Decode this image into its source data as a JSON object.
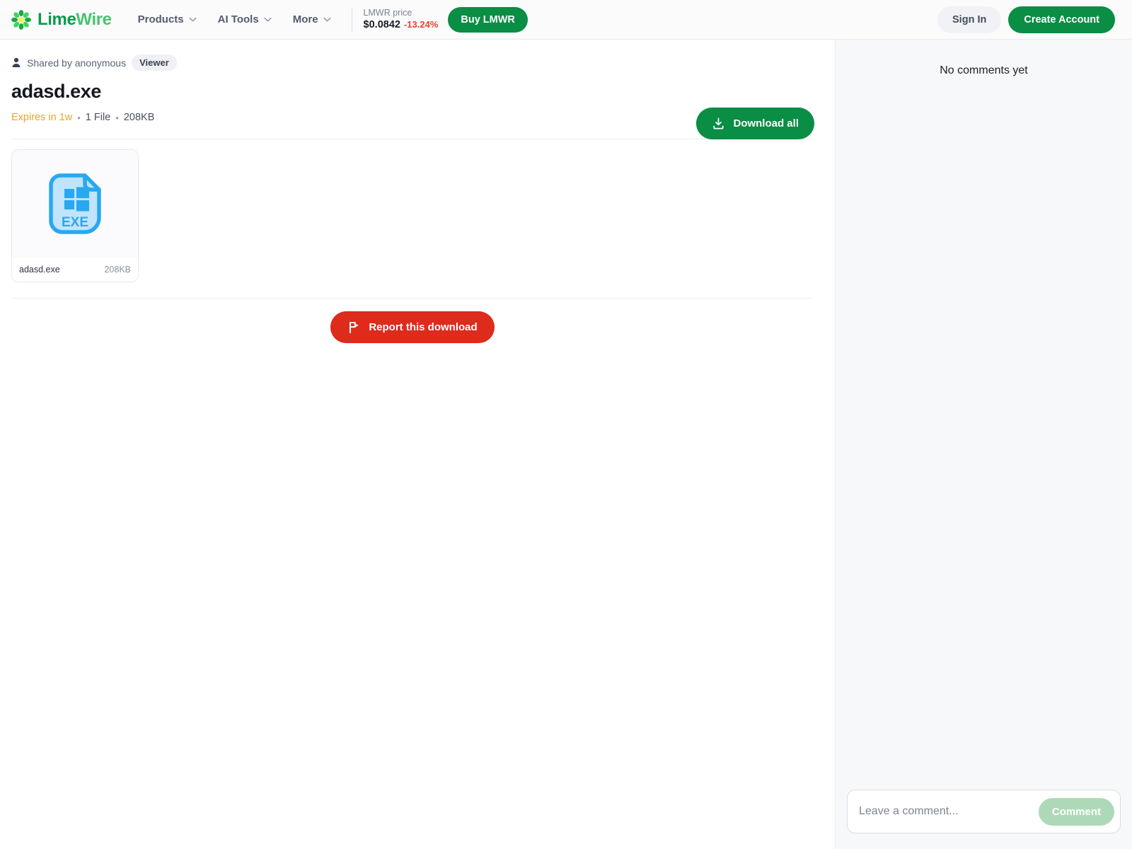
{
  "header": {
    "logo": {
      "icon": "limewire-flower-icon",
      "text_primary": "Lime",
      "text_secondary": "Wire"
    },
    "nav": [
      {
        "label": "Products",
        "icon": "chevron-down-icon"
      },
      {
        "label": "AI Tools",
        "icon": "chevron-down-icon"
      },
      {
        "label": "More",
        "icon": "chevron-down-icon"
      }
    ],
    "price": {
      "label": "LMWR price",
      "value": "$0.0842",
      "change": "-13.24%",
      "change_color": "#e8412c"
    },
    "buy_button": "Buy LMWR",
    "sign_in_button": "Sign In",
    "create_account_button": "Create Account"
  },
  "main": {
    "shared_by": "Shared by anonymous",
    "shared_by_icon": "person-icon",
    "role_badge": "Viewer",
    "title": "adasd.exe",
    "meta": {
      "expires": "Expires in 1w",
      "separator": "•",
      "file_count": "1 File",
      "total_size": "208KB",
      "expires_color": "#f0a32a"
    },
    "download_all_button": {
      "label": "Download all",
      "icon": "download-icon",
      "color": "#0a8d45"
    },
    "files": [
      {
        "name": "adasd.exe",
        "size": "208KB",
        "type_label": "EXE",
        "icon": "exe-file-icon",
        "icon_color": "#29a8f0"
      }
    ],
    "report_button": {
      "label": "Report this download",
      "icon": "flag-icon",
      "color": "#dd2b1c"
    }
  },
  "sidebar": {
    "empty_state": "No comments yet",
    "comment_input_placeholder": "Leave a comment...",
    "comment_input_value": "",
    "comment_submit_label": "Comment",
    "comment_submit_color": "#aed9b8"
  }
}
